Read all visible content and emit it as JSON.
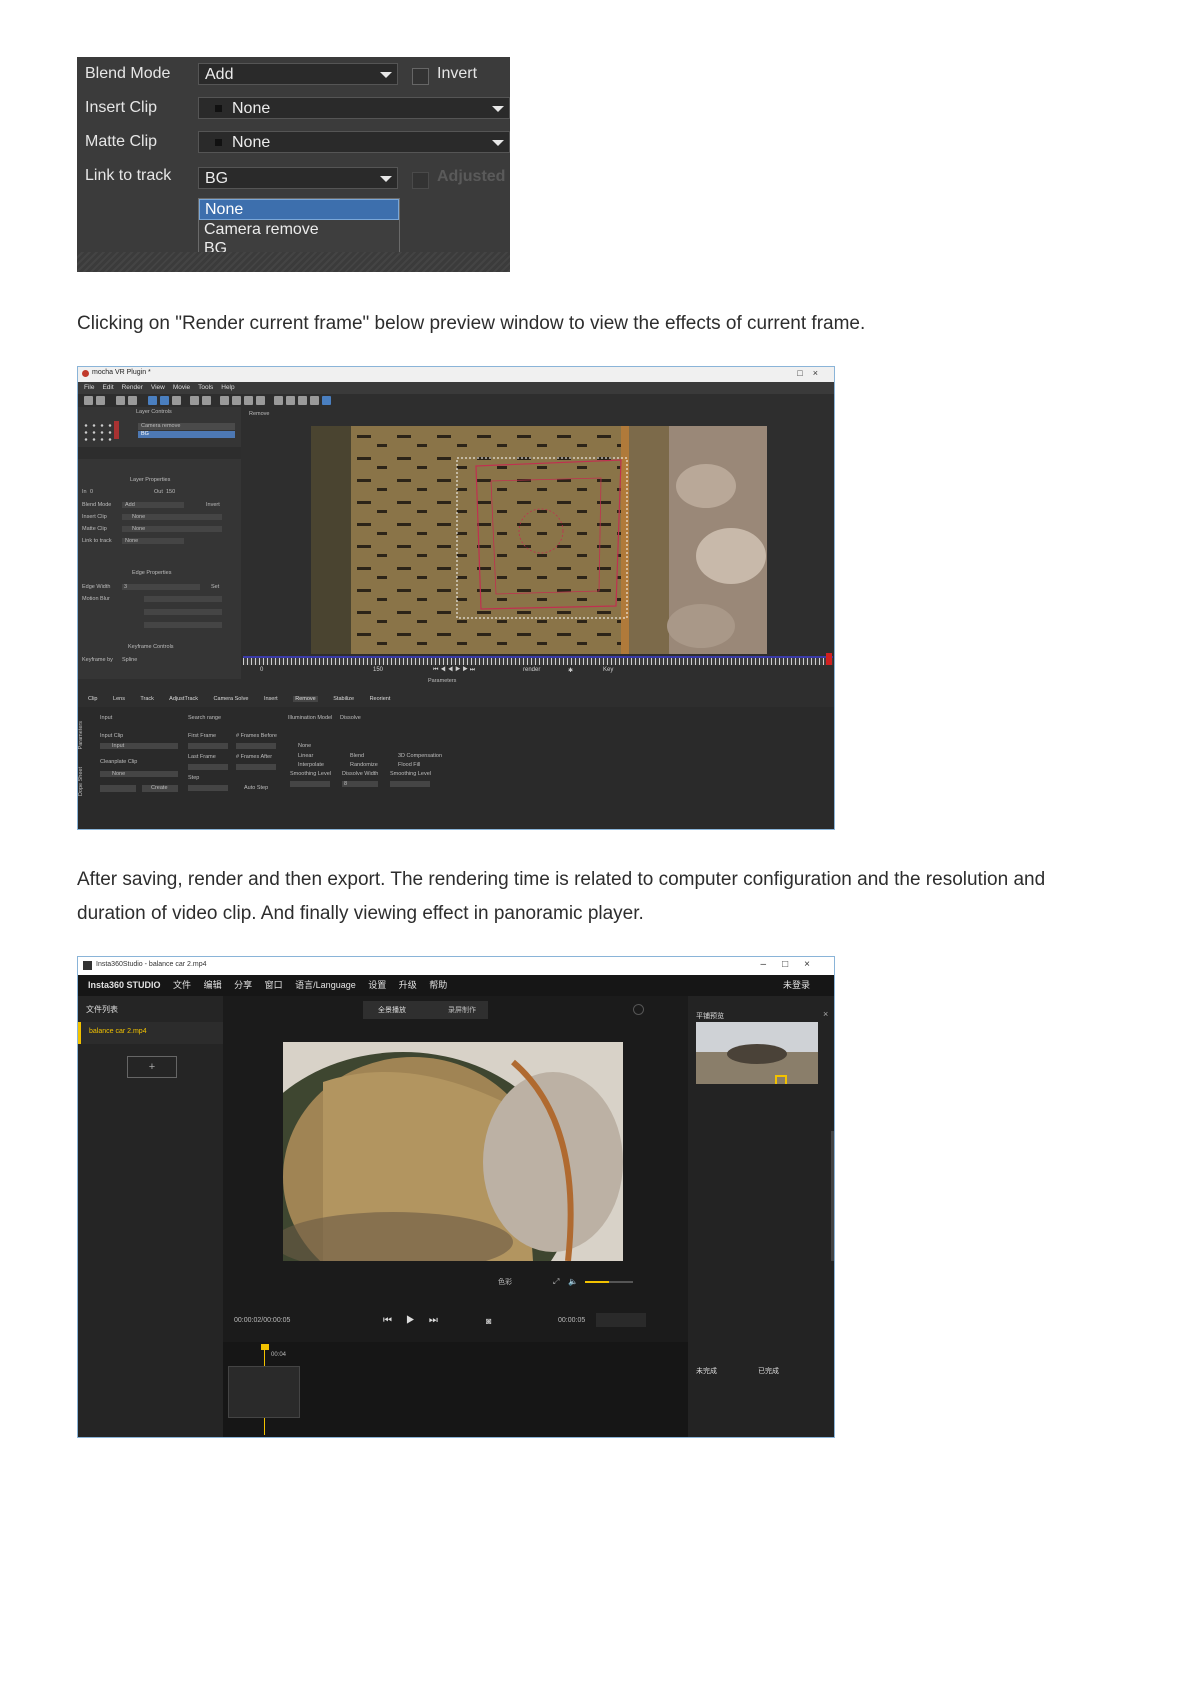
{
  "panel1": {
    "rows": [
      {
        "label": "Blend Mode",
        "value": "Add"
      },
      {
        "label": "Insert Clip",
        "value": "None"
      },
      {
        "label": "Matte Clip",
        "value": "None"
      },
      {
        "label": "Link to track",
        "value": "BG"
      }
    ],
    "invert_label": "Invert",
    "adjusted_label": "Adjusted",
    "dropdown_options": [
      "None",
      "Camera remove",
      "BG"
    ],
    "selected_option": "None"
  },
  "paragraph1": "Clicking on \"Render current frame\" below preview window to view the effects of current frame.",
  "panel2": {
    "window_title": "mocha VR Plugin *",
    "menu": [
      "File",
      "Edit",
      "Render",
      "View",
      "Movie",
      "Tools",
      "Help"
    ],
    "sidebar": {
      "layer_controls": "Layer Controls",
      "layers": [
        "Camera remove",
        "BG"
      ],
      "layer_properties": "Layer Properties",
      "in_label": "In",
      "in_value": "0",
      "out_label": "Out",
      "out_value": "150",
      "blend_mode_label": "Blend Mode",
      "blend_mode_value": "Add",
      "invert_label": "Invert",
      "insert_clip_label": "Insert Clip",
      "insert_clip_value": "None",
      "matte_clip_label": "Matte Clip",
      "matte_clip_value": "None",
      "link_label": "Link to track",
      "link_value": "None",
      "edge_properties": "Edge Properties",
      "edge_width_label": "Edge Width",
      "edge_width_value": "3",
      "set_label": "Set",
      "motion_blur_label": "Motion Blur",
      "keyframe_controls": "Keyframe Controls",
      "keyframe_by_label": "Keyframe by",
      "keyframe_by_value": "Spline"
    },
    "view_mode": "Remove",
    "timeline_start": "0",
    "timeline_end": "150",
    "render_label": "render",
    "key_label": "Key",
    "parameters_label": "Parameters",
    "tabs": [
      "Clip",
      "Lens",
      "Track",
      "AdjustTrack",
      "Camera Solve",
      "Insert",
      "Remove",
      "Stabilize",
      "Reorient"
    ],
    "side_tabs": [
      "Parameters",
      "Dope Sheet"
    ],
    "bottom": {
      "input_label": "Input",
      "input_clip_label": "Input Clip",
      "input_clip_value": "Input",
      "cleanplate_label": "Cleanplate Clip",
      "cleanplate_value": "None",
      "create_label": "Create",
      "search_range": "Search range",
      "first_frame": "First Frame",
      "frames_before": "# Frames Before",
      "last_frame": "Last Frame",
      "frames_after": "# Frames After",
      "step": "Step",
      "auto_step": "Auto Step",
      "illumination_model": "Illumination Model",
      "dissolve": "Dissolve",
      "none": "None",
      "blend": "Blend",
      "comp3d": "3D Compensation",
      "linear": "Linear",
      "randomize": "Randomize",
      "flood_fill": "Flood Fill",
      "interpolate": "Interpolate",
      "smoothing_level": "Smoothing Level",
      "dissolve_width": "Dissolve Width",
      "dissolve_width_value": "8",
      "smoothing_level2": "Smoothing Level"
    }
  },
  "paragraph2": "After saving, render and then export. The rendering time is related to computer configuration and the resolution and duration of video clip. And finally viewing effect in panoramic player.",
  "panel3": {
    "window_title": "Insta360Studio - balance car 2.mp4",
    "menu": [
      "Insta360 STUDIO",
      "文件",
      "编辑",
      "分享",
      "窗口",
      "语言/Language",
      "设置",
      "升级",
      "帮助"
    ],
    "login": "未登录",
    "file_list": "文件列表",
    "file_item": "balance car 2.mp4",
    "add_label": "+",
    "mode_tabs": [
      "全景播放",
      "录屏制作"
    ],
    "preview_title": "平铺预览",
    "color_label": "色彩",
    "time_current": "00:00:02/00:00:05",
    "time_end": "00:00:05",
    "playhead_time": "00:04",
    "status_pending": "未完成",
    "status_done": "已完成"
  },
  "colors": {
    "text": "#2d2d2d",
    "selection_blue": "#3d6fad",
    "mocha_bg": "#2e2e2e",
    "insta_bg": "#1f1f1f",
    "insta_accent": "#f2c200"
  }
}
